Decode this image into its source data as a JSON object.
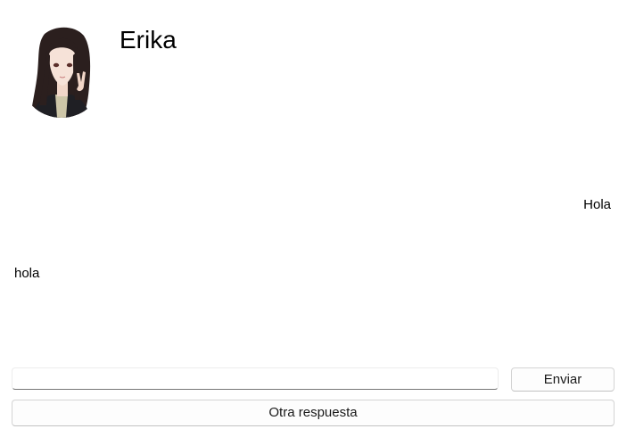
{
  "header": {
    "contact_name": "Erika",
    "avatar_icon": "anime-girl-avatar"
  },
  "messages": [
    {
      "side": "right",
      "text": "Hola"
    },
    {
      "side": "left",
      "text": "hola"
    }
  ],
  "composer": {
    "input_value": "",
    "input_placeholder": "",
    "send_label": "Enviar",
    "other_reply_label": "Otra respuesta"
  }
}
